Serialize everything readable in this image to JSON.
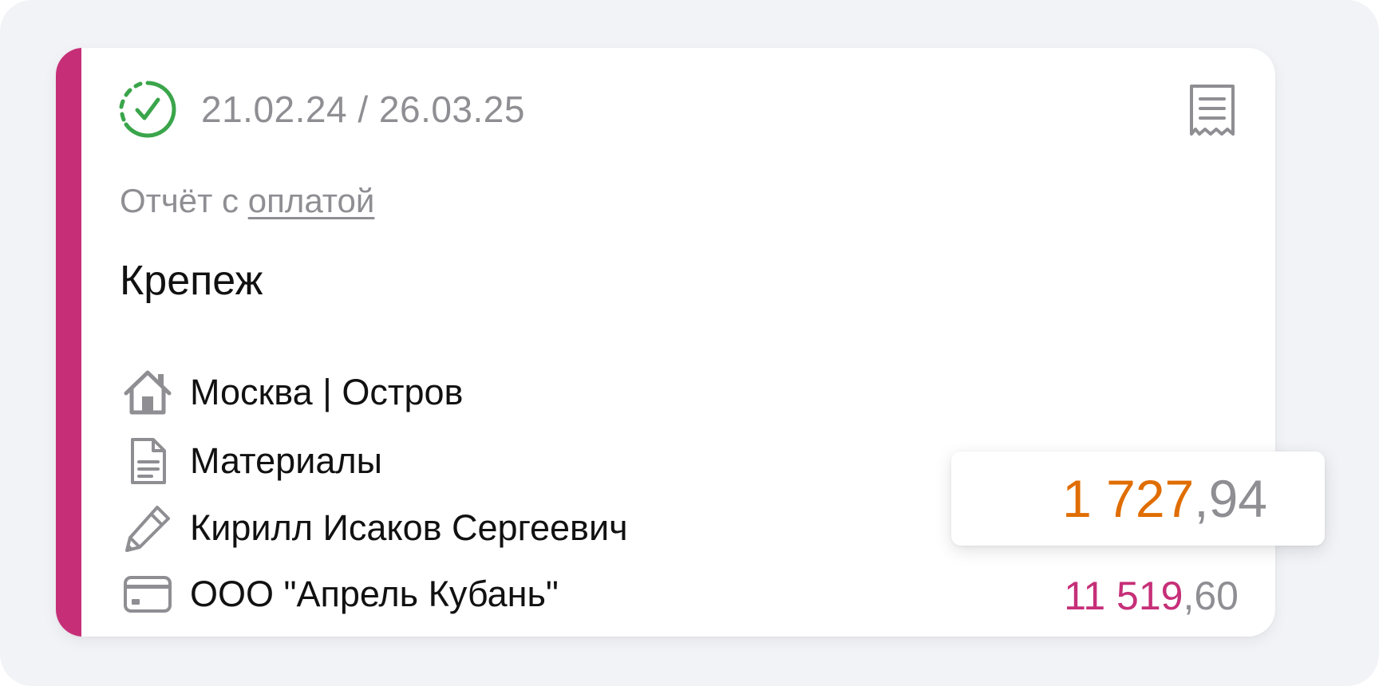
{
  "card": {
    "status": "completed-icon",
    "dates": "21.02.24 / 26.03.25",
    "report_prefix": "Отчёт с ",
    "report_link": "оплатой",
    "title": "Крепеж",
    "rows": [
      {
        "icon": "house-icon",
        "text": "Москва | Остров"
      },
      {
        "icon": "document-icon",
        "text": "Материалы"
      },
      {
        "icon": "pencil-icon",
        "text": "Кирилл Исаков Сергеевич"
      },
      {
        "icon": "card-icon",
        "text": "ООО \"Апрель Кубань\""
      }
    ],
    "total_int": "11 519",
    "total_frac": ",60"
  },
  "tooltip": {
    "int": "1 727",
    "frac": ",94"
  },
  "colors": {
    "stripe": "#c62f78",
    "status_green": "#3aa54a",
    "tooltip_value": "#e06d00",
    "total_value": "#c62f78",
    "muted": "#8e8e93"
  }
}
